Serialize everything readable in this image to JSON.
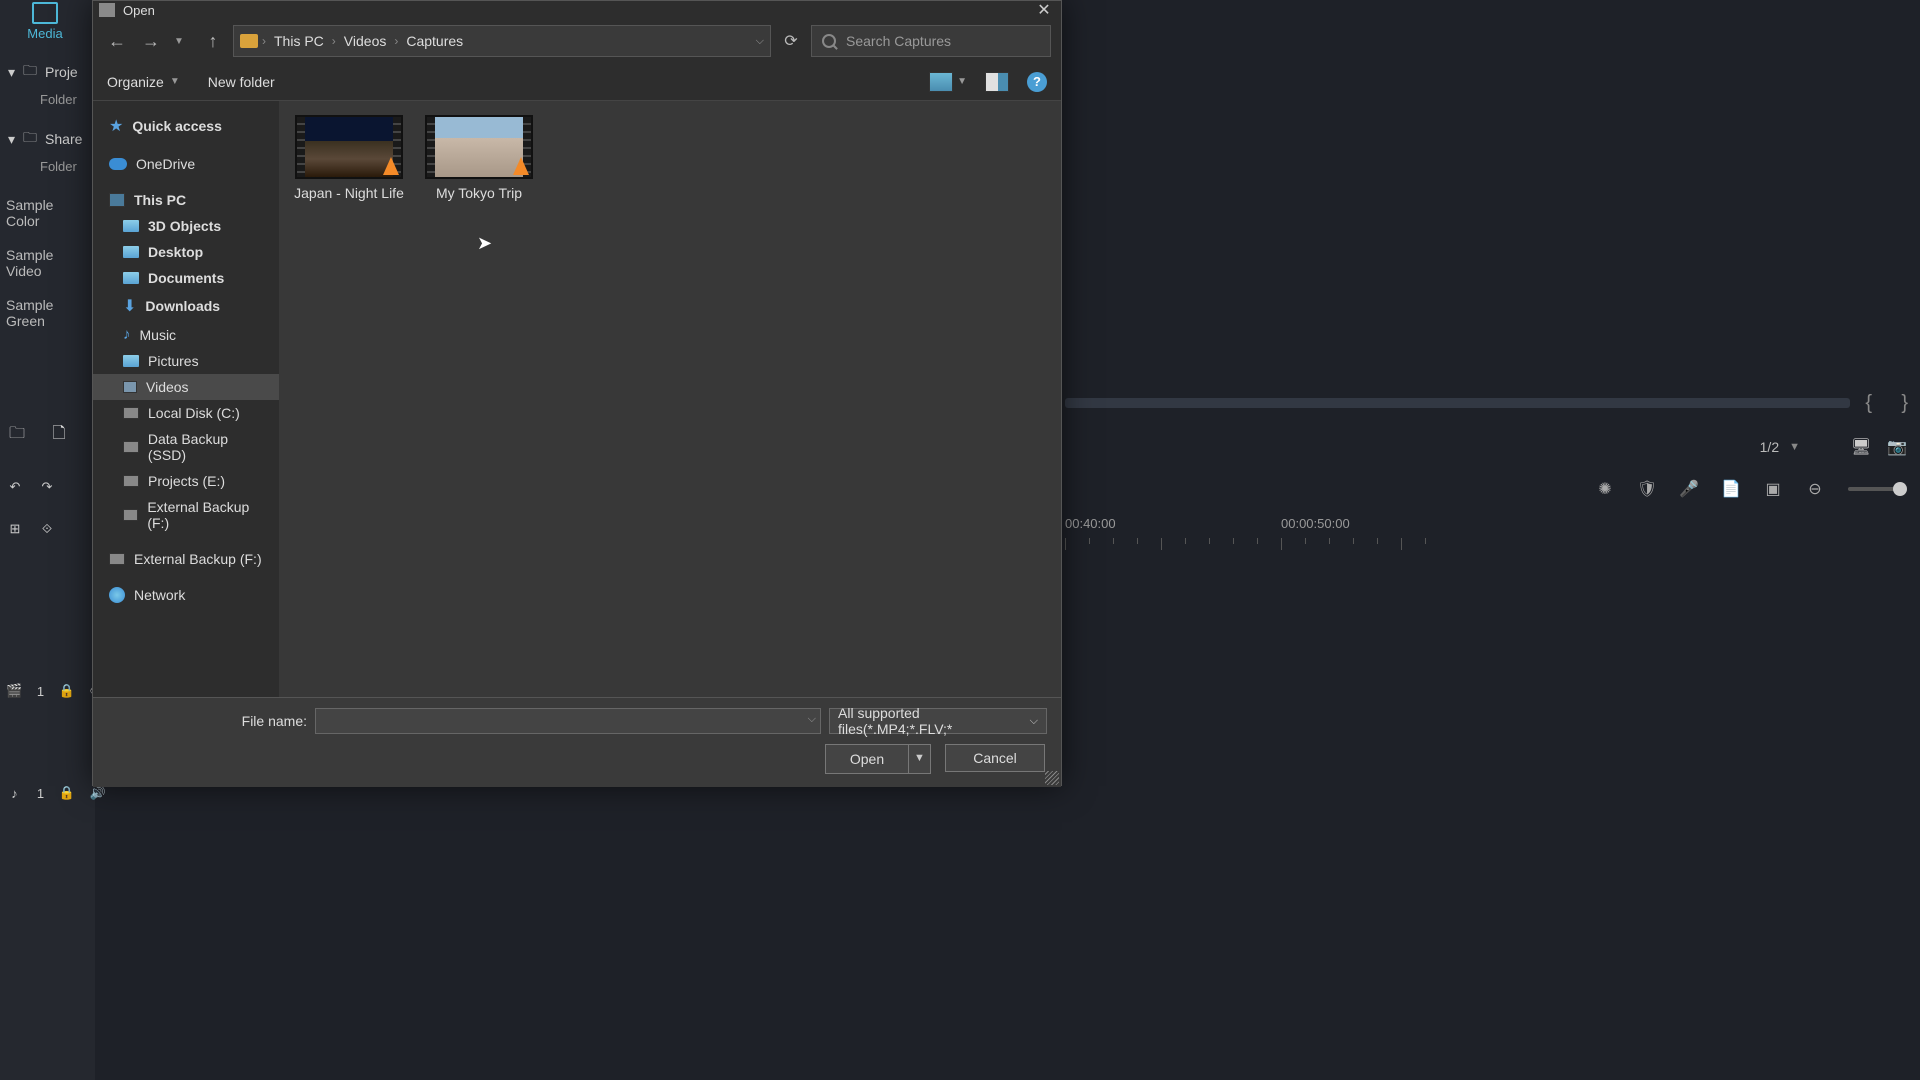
{
  "dialog": {
    "title": "Open",
    "path": [
      "This PC",
      "Videos",
      "Captures"
    ],
    "search_placeholder": "Search Captures",
    "organize": "Organize",
    "new_folder": "New folder",
    "file_name_label": "File name:",
    "file_name_value": "",
    "filter": "All supported files(*.MP4;*.FLV;*",
    "open_btn": "Open",
    "cancel_btn": "Cancel"
  },
  "tree": {
    "quick_access": "Quick access",
    "onedrive": "OneDrive",
    "this_pc": "This PC",
    "objects3d": "3D Objects",
    "desktop": "Desktop",
    "documents": "Documents",
    "downloads": "Downloads",
    "music": "Music",
    "pictures": "Pictures",
    "videos": "Videos",
    "local_disk": "Local Disk (C:)",
    "data_backup": "Data Backup (SSD)",
    "projects_e": "Projects (E:)",
    "ext_backup_f1": "External Backup (F:)",
    "ext_backup_f2": "External Backup (F:)",
    "network": "Network"
  },
  "files": {
    "f1": "Japan - Night Life",
    "f2": "My Tokyo Trip"
  },
  "editor": {
    "media_tab": "Media",
    "proje": "Proje",
    "folder": "Folder",
    "shared": "Share",
    "sample_colors": "Sample Color",
    "sample_videos": "Sample Video",
    "sample_green": "Sample Green",
    "frac": "1/2",
    "t40": "00:40:00",
    "t50": "00:00:50:00",
    "track_v1": "1",
    "track_a1": "1"
  }
}
